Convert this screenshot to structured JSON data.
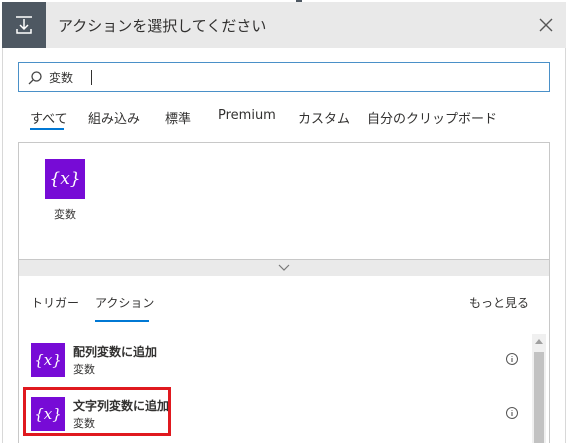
{
  "header": {
    "title": "アクションを選択してください",
    "icon": "download-tray-icon",
    "close_icon": "close-icon"
  },
  "search": {
    "value": "変数",
    "icon": "search-icon"
  },
  "tabs": [
    {
      "label": "すべて",
      "active": true
    },
    {
      "label": "組み込み",
      "active": false
    },
    {
      "label": "標準",
      "active": false
    },
    {
      "label": "Premium",
      "active": false
    },
    {
      "label": "カスタム",
      "active": false
    },
    {
      "label": "自分のクリップボード",
      "active": false
    }
  ],
  "connectors": [
    {
      "label": "変数",
      "icon_text": "{x}",
      "color": "#770bd6"
    }
  ],
  "subtabs": [
    {
      "label": "トリガー",
      "active": false
    },
    {
      "label": "アクション",
      "active": true
    }
  ],
  "see_more": "もっと見る",
  "actions": [
    {
      "title": "配列変数に追加",
      "subtitle": "変数",
      "icon_text": "{x}"
    },
    {
      "title": "文字列変数に追加",
      "subtitle": "変数",
      "icon_text": "{x}"
    }
  ],
  "colors": {
    "accent": "#0078d4",
    "variable_tile": "#770bd6",
    "highlight": "#e0191f"
  }
}
